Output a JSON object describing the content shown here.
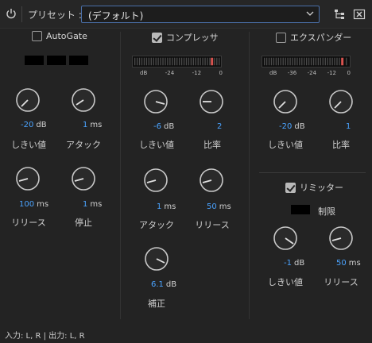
{
  "header": {
    "preset_label": "プリセット :",
    "preset_value": "(デフォルト)",
    "accent": "#4a6fa8"
  },
  "autogate": {
    "label": "AutoGate",
    "enabled": false,
    "threshold": {
      "value": "-20",
      "unit": "dB",
      "label": "しきい値"
    },
    "attack": {
      "value": "1",
      "unit": "ms",
      "label": "アタック"
    },
    "release": {
      "value": "100",
      "unit": "ms",
      "label": "リリース"
    },
    "hold": {
      "value": "1",
      "unit": "ms",
      "label": "停止"
    }
  },
  "compressor": {
    "label": "コンプレッサ",
    "enabled": true,
    "scale": [
      "dB",
      "-24",
      "-12",
      "0"
    ],
    "threshold": {
      "value": "-6",
      "unit": "dB",
      "label": "しきい値"
    },
    "ratio": {
      "value": "2",
      "unit": "",
      "label": "比率"
    },
    "attack": {
      "value": "1",
      "unit": "ms",
      "label": "アタック"
    },
    "release": {
      "value": "50",
      "unit": "ms",
      "label": "リリース"
    },
    "makeup": {
      "value": "6.1",
      "unit": "dB",
      "label": "補正"
    }
  },
  "expander": {
    "label": "エクスパンダー",
    "enabled": false,
    "scale": [
      "dB",
      "-36",
      "-24",
      "-12",
      "0"
    ],
    "threshold": {
      "value": "-20",
      "unit": "dB",
      "label": "しきい値"
    },
    "ratio": {
      "value": "1",
      "unit": "",
      "label": "比率"
    }
  },
  "limiter": {
    "label": "リミッター",
    "enabled": true,
    "limit_label": "制限",
    "threshold": {
      "value": "-1",
      "unit": "dB",
      "label": "しきい値"
    },
    "release": {
      "value": "50",
      "unit": "ms",
      "label": "リリース"
    }
  },
  "status": "入力: L, R | 出力: L, R",
  "colors": {
    "value_blue": "#4aa3ff",
    "meter_red": "#d9534f"
  }
}
